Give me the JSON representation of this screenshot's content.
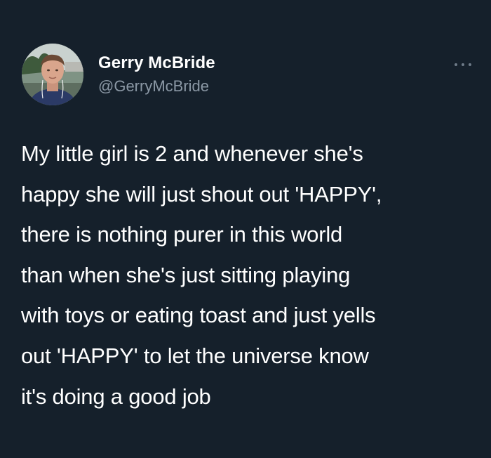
{
  "author": {
    "display_name": "Gerry McBride",
    "handle": "@GerryMcBride",
    "avatar_icon": "user-avatar-photo"
  },
  "menu_icon": "more-dots-icon",
  "tweet": {
    "lines": [
      "My little girl is 2 and whenever she's",
      "happy she will just shout out 'HAPPY',",
      "there is nothing purer in this world",
      "than when she's just sitting playing",
      "with toys or eating toast and just yells",
      "out 'HAPPY' to let the universe know",
      "it's doing a good job"
    ]
  },
  "colors": {
    "background": "#15202b",
    "text": "#ffffff",
    "secondary_text": "#8b98a5"
  }
}
